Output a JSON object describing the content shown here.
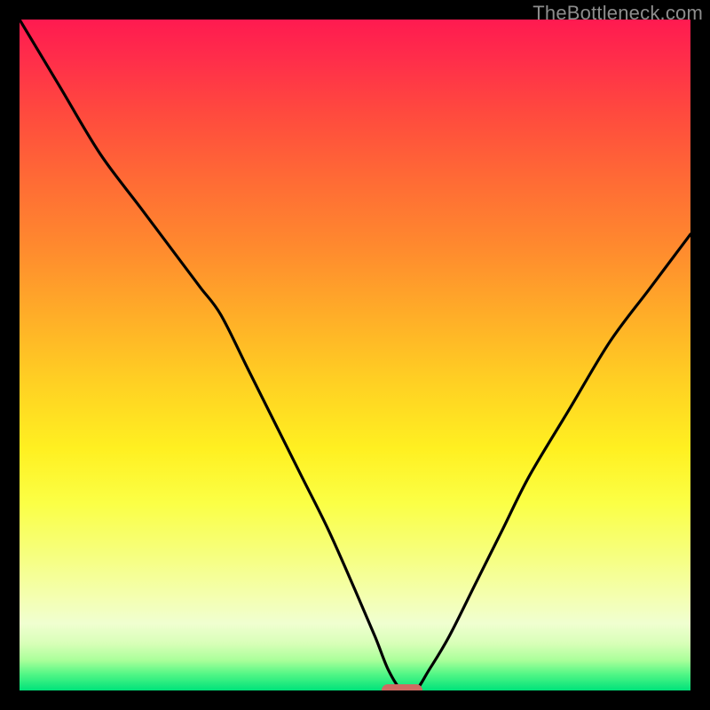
{
  "watermark": "TheBottleneck.com",
  "marker": {
    "x_pct": 57
  },
  "chart_data": {
    "type": "line",
    "title": "",
    "xlabel": "",
    "ylabel": "",
    "xlim": [
      0,
      100
    ],
    "ylim": [
      0,
      100
    ],
    "series": [
      {
        "name": "bottleneck-curve",
        "x": [
          0,
          6,
          12,
          18,
          24,
          27,
          30,
          34,
          38,
          42,
          46,
          50,
          53,
          55,
          57,
          59,
          61,
          64,
          68,
          72,
          76,
          82,
          88,
          94,
          100
        ],
        "y": [
          100,
          90,
          80,
          72,
          64,
          60,
          56,
          48,
          40,
          32,
          24,
          15,
          8,
          3,
          0,
          0,
          3,
          8,
          16,
          24,
          32,
          42,
          52,
          60,
          68
        ]
      }
    ],
    "annotations": [
      {
        "name": "optimal-marker",
        "x": 57,
        "y": 0
      }
    ]
  }
}
